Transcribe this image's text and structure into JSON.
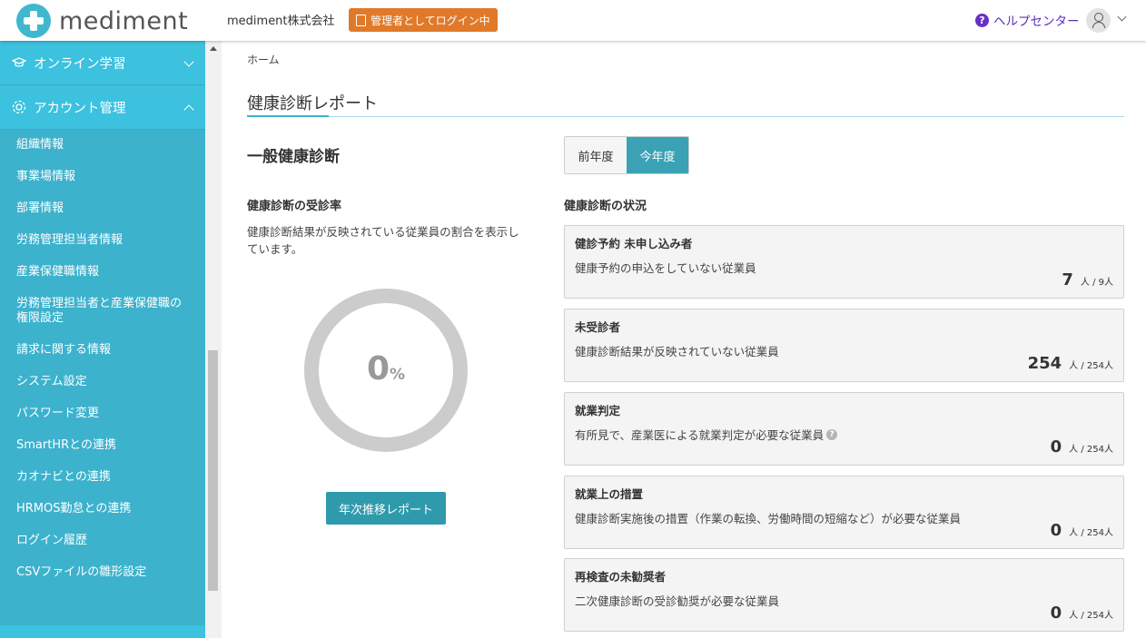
{
  "header": {
    "logo_text": "mediment",
    "company": "mediment株式会社",
    "admin_badge": "管理者としてログイン中",
    "help_label": "ヘルプセンター"
  },
  "sidebar": {
    "sections": [
      {
        "label": "オンライン学習",
        "expanded": false
      },
      {
        "label": "アカウント管理",
        "expanded": true
      }
    ],
    "items": [
      "組織情報",
      "事業場情報",
      "部署情報",
      "労務管理担当者情報",
      "産業保健職情報",
      "労務管理担当者と産業保健職の権限設定",
      "請求に関する情報",
      "システム設定",
      "パスワード変更",
      "SmartHRとの連携",
      "カオナビとの連携",
      "HRMOS勤怠との連携",
      "ログイン履歴",
      "CSVファイルの雛形設定"
    ]
  },
  "main": {
    "breadcrumb": "ホーム",
    "page_title": "健康診断レポート",
    "section_title": "一般健康診断",
    "year_toggle": {
      "prev": "前年度",
      "current": "今年度",
      "selected": "今年度"
    },
    "rate": {
      "title": "健康診断の受診率",
      "description": "健康診断結果が反映されている従業員の割合を表示しています。",
      "value": "0",
      "unit": "%",
      "button": "年次推移レポート"
    },
    "status_title": "健康診断の状況",
    "cards": [
      {
        "title": "健診予約 未申し込み者",
        "desc": "健康予約の申込をしていない従業員",
        "count": "7",
        "total": "人 / 9人"
      },
      {
        "title": "未受診者",
        "desc": "健康診断結果が反映されていない従業員",
        "count": "254",
        "total": "人 / 254人"
      },
      {
        "title": "就業判定",
        "desc": "有所見で、産業医による就業判定が必要な従業員",
        "count": "0",
        "total": "人 / 254人"
      },
      {
        "title": "就業上の措置",
        "desc": "健康診断実施後の措置（作業の転換、労働時間の短縮など）が必要な従業員",
        "count": "0",
        "total": "人 / 254人"
      },
      {
        "title": "再検査の未勧奨者",
        "desc": "二次健康診断の受診勧奨が必要な従業員",
        "count": "0",
        "total": "人 / 254人"
      }
    ]
  }
}
